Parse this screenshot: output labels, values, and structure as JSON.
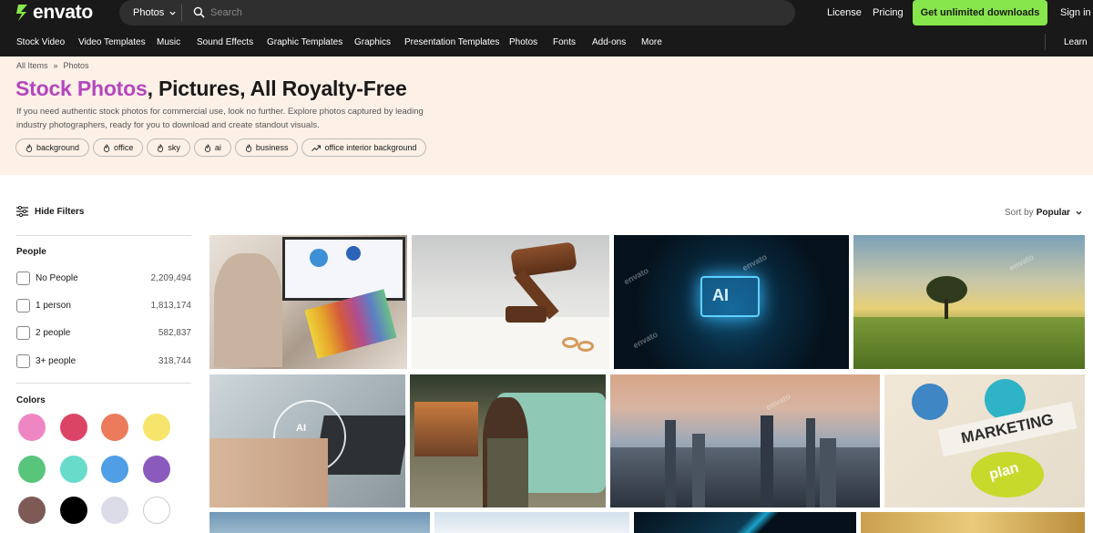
{
  "logo": "envato",
  "search": {
    "scope": "Photos",
    "placeholder": "Search"
  },
  "top_links": {
    "license": "License",
    "pricing": "Pricing",
    "cta": "Get unlimited downloads",
    "signin": "Sign in"
  },
  "categories": [
    "Stock Video",
    "Video Templates",
    "Music",
    "Sound Effects",
    "Graphic Templates",
    "Graphics",
    "Presentation Templates",
    "Photos",
    "Fonts",
    "Add-ons",
    "More"
  ],
  "learn": "Learn",
  "breadcrumb": [
    "All Items",
    "»",
    "Photos"
  ],
  "title": {
    "accent": "Stock Photos",
    "rest": ", Pictures, All Royalty-Free"
  },
  "description": "If you need authentic stock photos for commercial use, look no further. Explore photos captured by leading industry photographers, ready for you to download and create standout visuals.",
  "tags": [
    {
      "label": "background",
      "icon": "flame-icon"
    },
    {
      "label": "office",
      "icon": "flame-icon"
    },
    {
      "label": "sky",
      "icon": "flame-icon"
    },
    {
      "label": "ai",
      "icon": "flame-icon"
    },
    {
      "label": "business",
      "icon": "flame-icon"
    },
    {
      "label": "office interior background",
      "icon": "trending-icon"
    }
  ],
  "filters": {
    "toggle_label": "Hide Filters",
    "people_title": "People",
    "people": [
      {
        "label": "No People",
        "count": "2,209,494"
      },
      {
        "label": "1 person",
        "count": "1,813,174"
      },
      {
        "label": "2 people",
        "count": "582,837"
      },
      {
        "label": "3+ people",
        "count": "318,744"
      }
    ],
    "colors_title": "Colors",
    "colors": [
      "#ef86c4",
      "#dc4466",
      "#ec7b5b",
      "#f7e46a",
      "#58c57a",
      "#68dbcb",
      "#4f9ee6",
      "#8a5bbd",
      "#7d5a56",
      "#000000",
      "#dcdbe8",
      "#ffffff"
    ]
  },
  "sort": {
    "prefix": "Sort by",
    "value": "Popular"
  },
  "watermark": "envato"
}
